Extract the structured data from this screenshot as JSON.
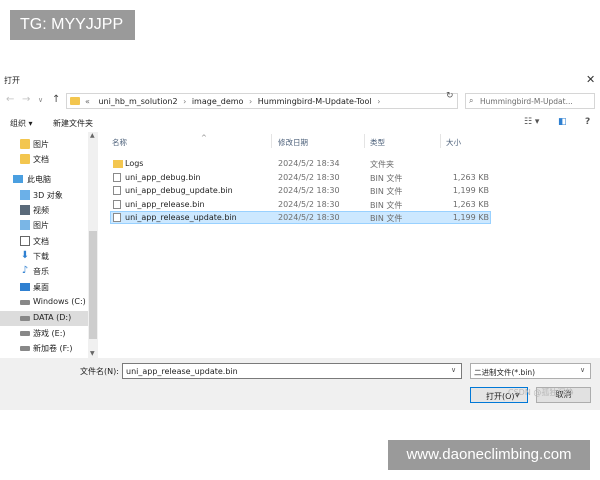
{
  "watermark_top": "TG: MYYJJPP",
  "watermark_bottom": "www.daoneclimbing.com",
  "dialog": {
    "title": "打开",
    "close_glyph": "✕"
  },
  "nav": {
    "back": "←",
    "forward": "→",
    "recent": "∨",
    "up": "↑"
  },
  "address": {
    "prefix": "«",
    "crumbs": [
      "uni_hb_m_solution2",
      "image_demo",
      "Hummingbird-M-Update-Tool"
    ],
    "separator": "›",
    "dropdown_glyph": "∨",
    "refresh_glyph": "↻"
  },
  "search": {
    "icon_glyph": "⌕",
    "placeholder": "Hummingbird-M-Updat..."
  },
  "toolbar": {
    "organize": "组织 ▾",
    "new_folder": "新建文件夹",
    "view_glyph": "☷ ▾",
    "pane_glyph": "◧",
    "help_glyph": "?"
  },
  "sidebar": {
    "items": [
      {
        "label": "图片",
        "icon": "folder-icon"
      },
      {
        "label": "文档",
        "icon": "folder-icon"
      },
      {
        "label": "此电脑",
        "icon": "pc-icon"
      },
      {
        "label": "3D 对象",
        "icon": "3d-objects-icon"
      },
      {
        "label": "视频",
        "icon": "video-icon"
      },
      {
        "label": "图片",
        "icon": "pictures-icon"
      },
      {
        "label": "文档",
        "icon": "document-icon"
      },
      {
        "label": "下载",
        "icon": "download-icon",
        "glyph": "⬇"
      },
      {
        "label": "音乐",
        "icon": "music-icon",
        "glyph": "♪"
      },
      {
        "label": "桌面",
        "icon": "desktop-icon"
      },
      {
        "label": "Windows (C:)",
        "icon": "drive-icon"
      },
      {
        "label": "DATA (D:)",
        "icon": "drive-icon",
        "selected": true
      },
      {
        "label": "游戏 (E:)",
        "icon": "drive-icon"
      },
      {
        "label": "新加卷 (F:)",
        "icon": "drive-icon"
      }
    ],
    "scroll_up": "▲",
    "scroll_down": "▼"
  },
  "columns": {
    "name": "名称",
    "modified": "修改日期",
    "type": "类型",
    "size": "大小",
    "sort_glyph": "^"
  },
  "files": [
    {
      "name": "Logs",
      "modified": "2024/5/2 18:34",
      "type": "文件夹",
      "size": "",
      "kind": "folder"
    },
    {
      "name": "uni_app_debug.bin",
      "modified": "2024/5/2 18:30",
      "type": "BIN 文件",
      "size": "1,263 KB",
      "kind": "file"
    },
    {
      "name": "uni_app_debug_update.bin",
      "modified": "2024/5/2 18:30",
      "type": "BIN 文件",
      "size": "1,199 KB",
      "kind": "file"
    },
    {
      "name": "uni_app_release.bin",
      "modified": "2024/5/2 18:30",
      "type": "BIN 文件",
      "size": "1,263 KB",
      "kind": "file"
    },
    {
      "name": "uni_app_release_update.bin",
      "modified": "2024/5/2 18:30",
      "type": "BIN 文件",
      "size": "1,199 KB",
      "kind": "file",
      "selected": true
    }
  ],
  "footer": {
    "filename_label": "文件名(N):",
    "filename_value": "uni_app_release_update.bin",
    "filename_drop": "∨",
    "filetype": "二进制文件(*.bin)",
    "filetype_drop": "∨",
    "open_label": "打开(O)",
    "open_drop": "▼",
    "cancel_label": "取消",
    "csdn_mark": "CSDN @孤独沉静"
  },
  "colors": {
    "selection_bg": "#cce8ff",
    "selection_border": "#99d1ff",
    "folder": "#f3c64f",
    "accent": "#0078d7"
  }
}
